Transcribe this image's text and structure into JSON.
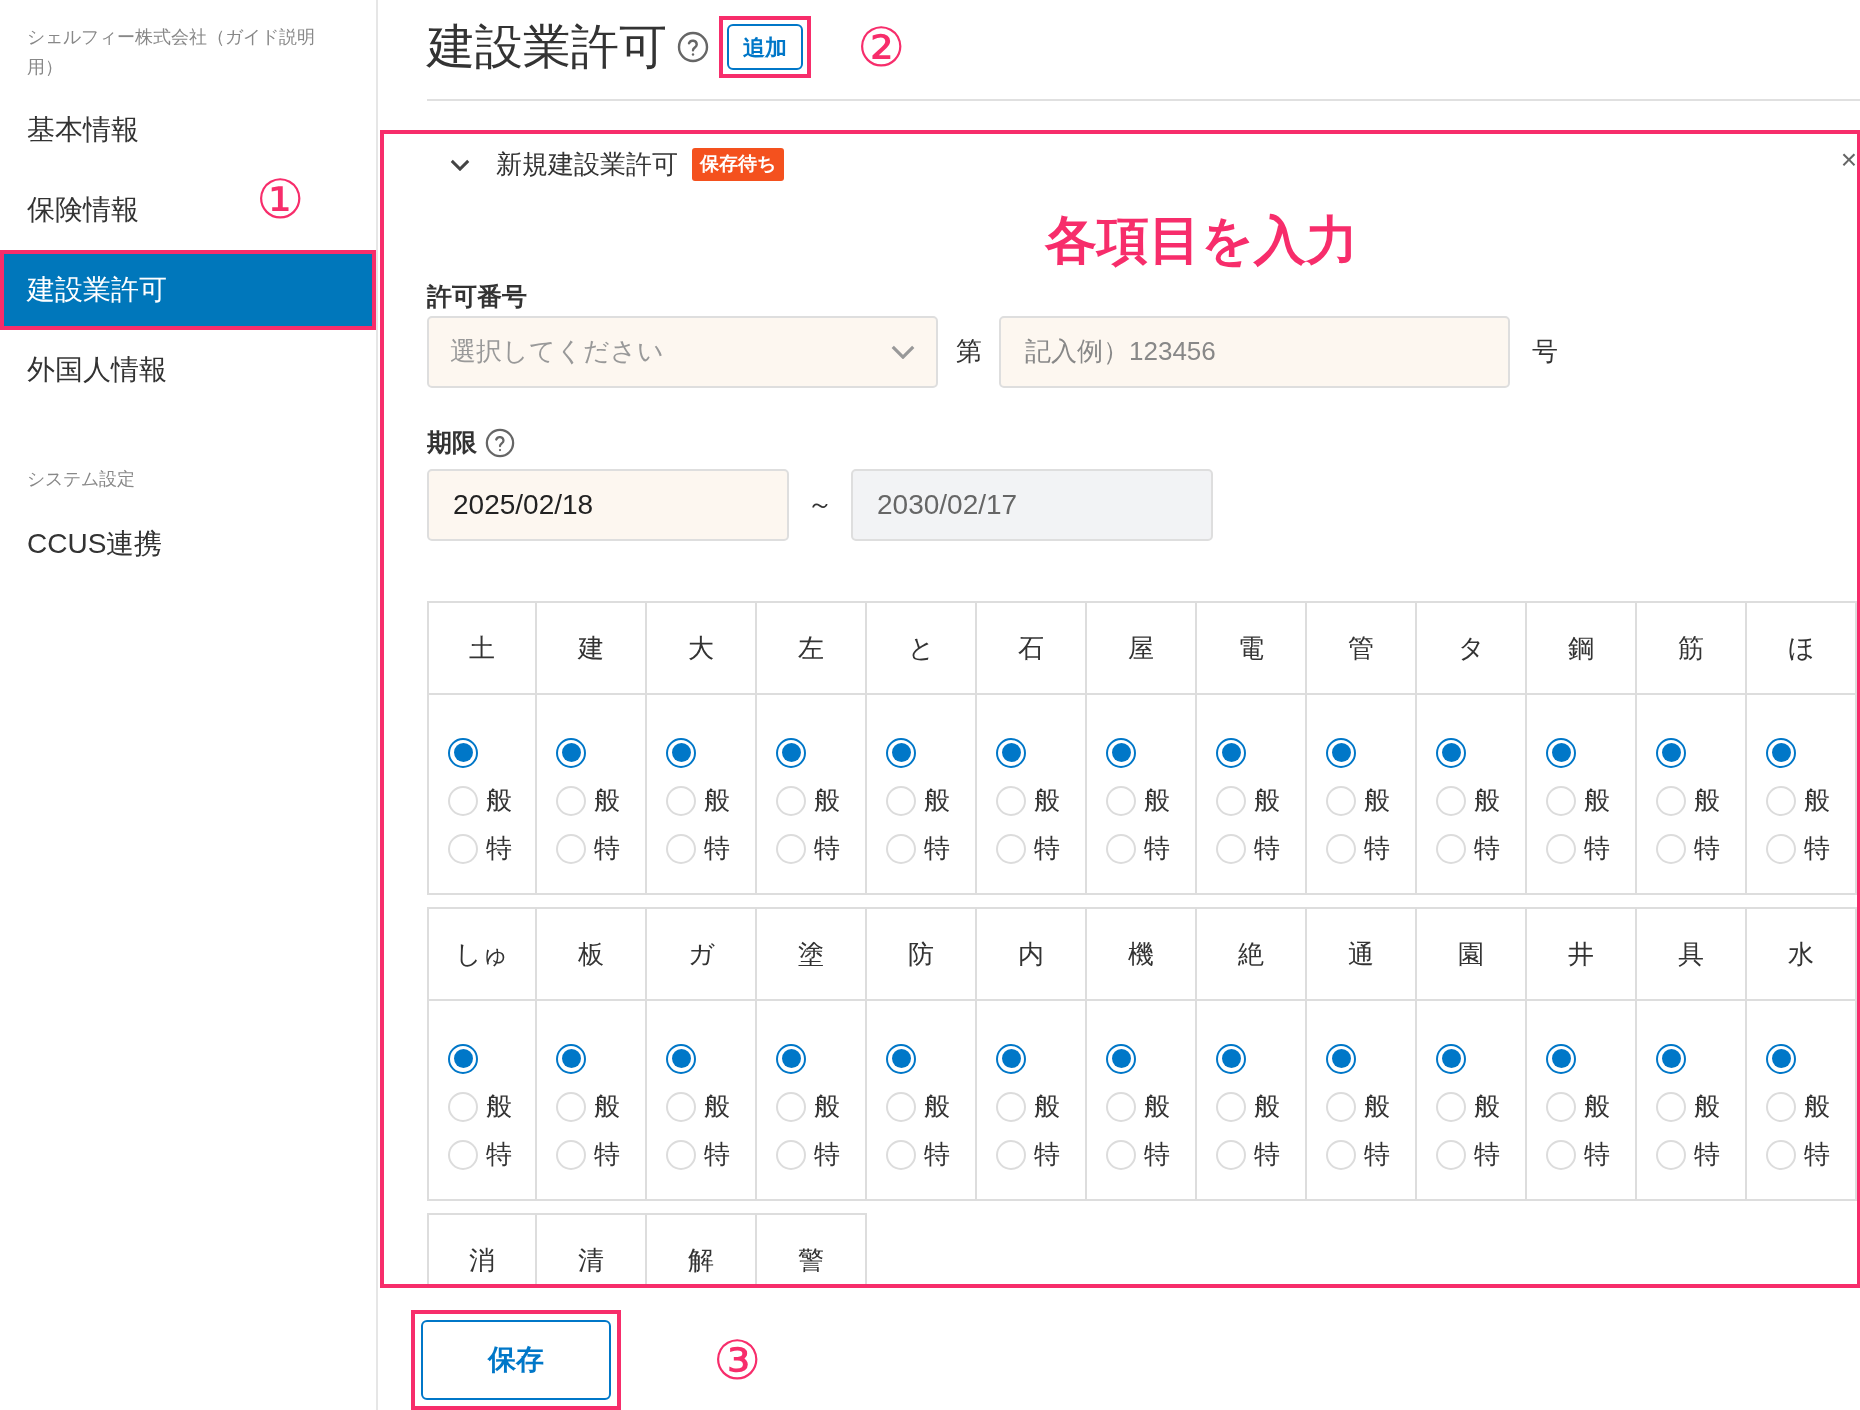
{
  "sidebar": {
    "company": "シェルフィー株式会社（ガイド説明用）",
    "items": [
      {
        "label": "基本情報",
        "selected": false,
        "highlighted": false
      },
      {
        "label": "保険情報",
        "selected": false,
        "highlighted": false
      },
      {
        "label": "建設業許可",
        "selected": true,
        "highlighted": true
      },
      {
        "label": "外国人情報",
        "selected": false,
        "highlighted": false
      }
    ],
    "section_title": "システム設定",
    "section_items": [
      {
        "label": "CCUS連携",
        "selected": false,
        "highlighted": false
      }
    ]
  },
  "annotations": {
    "sidebar_marker": "①",
    "add_marker": "②",
    "save_marker": "③",
    "form_note": "各項目を入力"
  },
  "header": {
    "title": "建設業許可",
    "add_button": {
      "label": "追加",
      "highlighted": true
    }
  },
  "permit_panel": {
    "highlighted": true,
    "expanded": true,
    "title": "新規建設業許可",
    "badge": "保存待ち",
    "close": "×",
    "permit_number": {
      "label": "許可番号",
      "select_placeholder": "選択してください",
      "prefix": "第",
      "number_placeholder": "記入例）123456",
      "suffix": "号"
    },
    "period": {
      "label": "期限",
      "start": "2025/02/18",
      "separator": "～",
      "end": "2030/02/17",
      "end_disabled": true
    },
    "trades": [
      {
        "label": "土",
        "options": [
          {
            "selected": true
          },
          {
            "label": "般",
            "selected": false
          },
          {
            "label": "特",
            "selected": false
          }
        ]
      },
      {
        "label": "建",
        "options": [
          {
            "selected": true
          },
          {
            "label": "般",
            "selected": false
          },
          {
            "label": "特",
            "selected": false
          }
        ]
      },
      {
        "label": "大",
        "options": [
          {
            "selected": true
          },
          {
            "label": "般",
            "selected": false
          },
          {
            "label": "特",
            "selected": false
          }
        ]
      },
      {
        "label": "左",
        "options": [
          {
            "selected": true
          },
          {
            "label": "般",
            "selected": false
          },
          {
            "label": "特",
            "selected": false
          }
        ]
      },
      {
        "label": "と",
        "options": [
          {
            "selected": true
          },
          {
            "label": "般",
            "selected": false
          },
          {
            "label": "特",
            "selected": false
          }
        ]
      },
      {
        "label": "石",
        "options": [
          {
            "selected": true
          },
          {
            "label": "般",
            "selected": false
          },
          {
            "label": "特",
            "selected": false
          }
        ]
      },
      {
        "label": "屋",
        "options": [
          {
            "selected": true
          },
          {
            "label": "般",
            "selected": false
          },
          {
            "label": "特",
            "selected": false
          }
        ]
      },
      {
        "label": "電",
        "options": [
          {
            "selected": true
          },
          {
            "label": "般",
            "selected": false
          },
          {
            "label": "特",
            "selected": false
          }
        ]
      },
      {
        "label": "管",
        "options": [
          {
            "selected": true
          },
          {
            "label": "般",
            "selected": false
          },
          {
            "label": "特",
            "selected": false
          }
        ]
      },
      {
        "label": "タ",
        "options": [
          {
            "selected": true
          },
          {
            "label": "般",
            "selected": false
          },
          {
            "label": "特",
            "selected": false
          }
        ]
      },
      {
        "label": "鋼",
        "options": [
          {
            "selected": true
          },
          {
            "label": "般",
            "selected": false
          },
          {
            "label": "特",
            "selected": false
          }
        ]
      },
      {
        "label": "筋",
        "options": [
          {
            "selected": true
          },
          {
            "label": "般",
            "selected": false
          },
          {
            "label": "特",
            "selected": false
          }
        ]
      },
      {
        "label": "ほ",
        "options": [
          {
            "selected": true
          },
          {
            "label": "般",
            "selected": false
          },
          {
            "label": "特",
            "selected": false
          }
        ]
      },
      {
        "label": "しゅ",
        "options": [
          {
            "selected": true
          },
          {
            "label": "般",
            "selected": false
          },
          {
            "label": "特",
            "selected": false
          }
        ]
      },
      {
        "label": "板",
        "options": [
          {
            "selected": true
          },
          {
            "label": "般",
            "selected": false
          },
          {
            "label": "特",
            "selected": false
          }
        ]
      },
      {
        "label": "ガ",
        "options": [
          {
            "selected": true
          },
          {
            "label": "般",
            "selected": false
          },
          {
            "label": "特",
            "selected": false
          }
        ]
      },
      {
        "label": "塗",
        "options": [
          {
            "selected": true
          },
          {
            "label": "般",
            "selected": false
          },
          {
            "label": "特",
            "selected": false
          }
        ]
      },
      {
        "label": "防",
        "options": [
          {
            "selected": true
          },
          {
            "label": "般",
            "selected": false
          },
          {
            "label": "特",
            "selected": false
          }
        ]
      },
      {
        "label": "内",
        "options": [
          {
            "selected": true
          },
          {
            "label": "般",
            "selected": false
          },
          {
            "label": "特",
            "selected": false
          }
        ]
      },
      {
        "label": "機",
        "options": [
          {
            "selected": true
          },
          {
            "label": "般",
            "selected": false
          },
          {
            "label": "特",
            "selected": false
          }
        ]
      },
      {
        "label": "絶",
        "options": [
          {
            "selected": true
          },
          {
            "label": "般",
            "selected": false
          },
          {
            "label": "特",
            "selected": false
          }
        ]
      },
      {
        "label": "通",
        "options": [
          {
            "selected": true
          },
          {
            "label": "般",
            "selected": false
          },
          {
            "label": "特",
            "selected": false
          }
        ]
      },
      {
        "label": "園",
        "options": [
          {
            "selected": true
          },
          {
            "label": "般",
            "selected": false
          },
          {
            "label": "特",
            "selected": false
          }
        ]
      },
      {
        "label": "井",
        "options": [
          {
            "selected": true
          },
          {
            "label": "般",
            "selected": false
          },
          {
            "label": "特",
            "selected": false
          }
        ]
      },
      {
        "label": "具",
        "options": [
          {
            "selected": true
          },
          {
            "label": "般",
            "selected": false
          },
          {
            "label": "特",
            "selected": false
          }
        ]
      },
      {
        "label": "水",
        "options": [
          {
            "selected": true
          },
          {
            "label": "般",
            "selected": false
          },
          {
            "label": "特",
            "selected": false
          }
        ]
      },
      {
        "label": "消"
      },
      {
        "label": "清"
      },
      {
        "label": "解"
      },
      {
        "label": "警"
      }
    ]
  },
  "save_button": {
    "label": "保存",
    "highlighted": true
  }
}
